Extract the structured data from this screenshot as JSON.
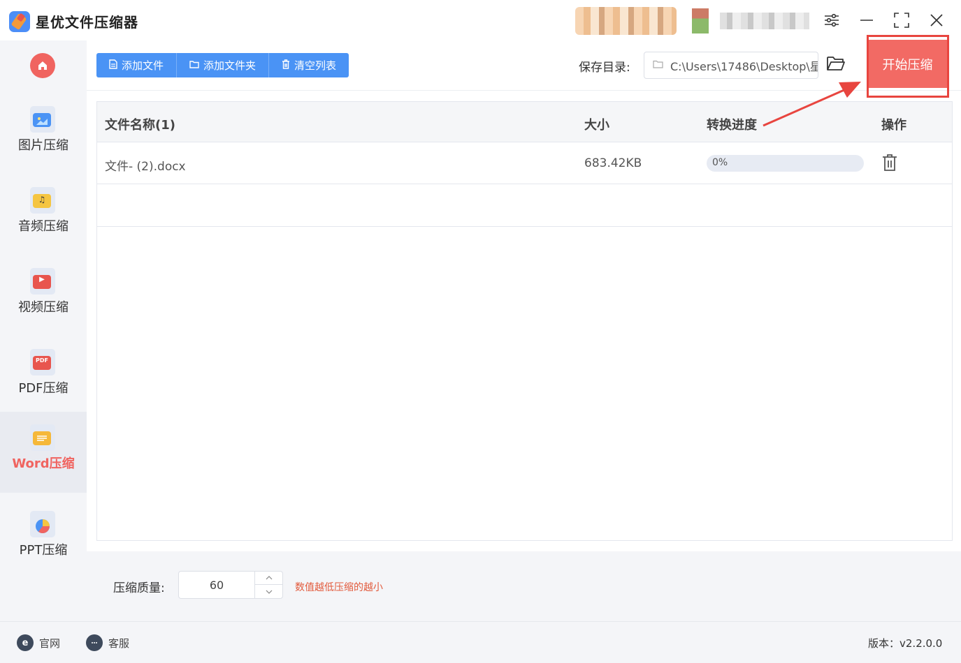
{
  "app": {
    "title": "星优文件压缩器"
  },
  "window": {
    "settings_icon": "sliders-icon",
    "minimize_icon": "minimize-icon",
    "maximize_icon": "maximize-icon",
    "close_icon": "close-icon"
  },
  "sidebar": {
    "home_icon": "home-icon",
    "items": [
      {
        "label": "图片压缩",
        "icon": "image-file-icon",
        "color": "#4a93f5"
      },
      {
        "label": "音频压缩",
        "icon": "audio-file-icon",
        "color": "#f5c542"
      },
      {
        "label": "视频压缩",
        "icon": "video-file-icon",
        "color": "#e8554e"
      },
      {
        "label": "PDF压缩",
        "icon": "pdf-file-icon",
        "glyph": "PDF",
        "color": "#e8554e"
      },
      {
        "label": "Word压缩",
        "icon": "word-file-icon",
        "color": "#f5b83a",
        "active": true
      },
      {
        "label": "PPT压缩",
        "icon": "ppt-file-icon",
        "color": "#f06460"
      }
    ]
  },
  "toolbar": {
    "add_file": "添加文件",
    "add_folder": "添加文件夹",
    "clear_list": "清空列表",
    "save_dir_label": "保存目录:",
    "save_dir_value": "C:\\Users\\17486\\Desktop\\星",
    "start": "开始压缩"
  },
  "table": {
    "headers": {
      "name": "文件名称(1)",
      "size": "大小",
      "progress": "转换进度",
      "action": "操作"
    },
    "rows": [
      {
        "name": "文件- (2).docx",
        "size": "683.42KB",
        "progress_text": "0%",
        "progress": 0
      }
    ]
  },
  "settings": {
    "quality_label": "压缩质量:",
    "quality_value": "60",
    "hint": "数值越低压缩的越小"
  },
  "footer": {
    "website": "官网",
    "support": "客服",
    "version": "版本：v2.2.0.0"
  },
  "colors": {
    "accent": "#4a93f5",
    "primary_action": "#f26a64",
    "annotation": "#e8453f"
  }
}
